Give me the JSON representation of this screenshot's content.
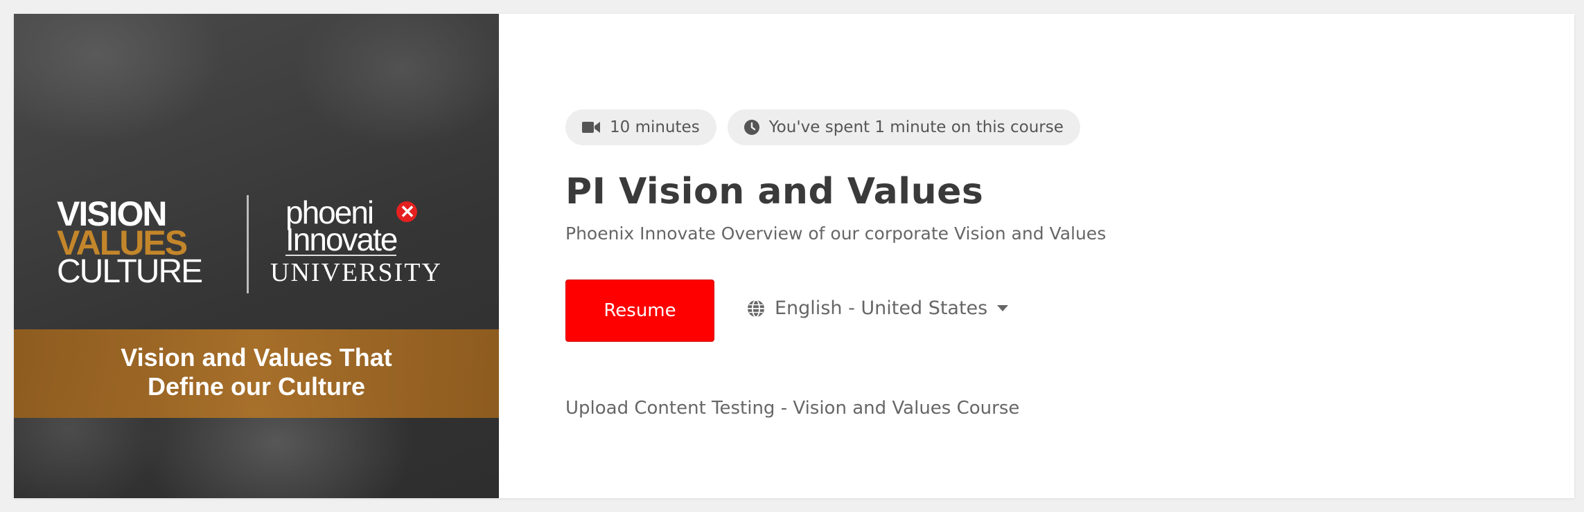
{
  "thumbnail": {
    "logo_left": {
      "line1": "VISION",
      "line2": "VALUES",
      "line3": "CULTURE"
    },
    "logo_right": {
      "line1": "phoeni",
      "line2": "Innovate",
      "line3": "UNIVERSITY",
      "mark": "✕"
    },
    "banner_line1": "Vision and Values That",
    "banner_line2": "Define our Culture",
    "colors": {
      "band": "#a56a24",
      "accent_orange": "#c4862a",
      "mark_red": "#e52020"
    }
  },
  "meta": {
    "duration": {
      "icon": "video-camera-icon",
      "label": "10 minutes"
    },
    "time_spent": {
      "icon": "clock-icon",
      "label": "You've spent 1 minute on this course"
    }
  },
  "course": {
    "title": "PI Vision and Values",
    "subtitle": "Phoenix Innovate Overview of our corporate Vision and Values",
    "note": "Upload Content Testing - Vision and Values Course"
  },
  "actions": {
    "resume_label": "Resume",
    "resume_color": "#ff0000",
    "language": {
      "icon": "globe-icon",
      "selected": "English - United States"
    }
  }
}
